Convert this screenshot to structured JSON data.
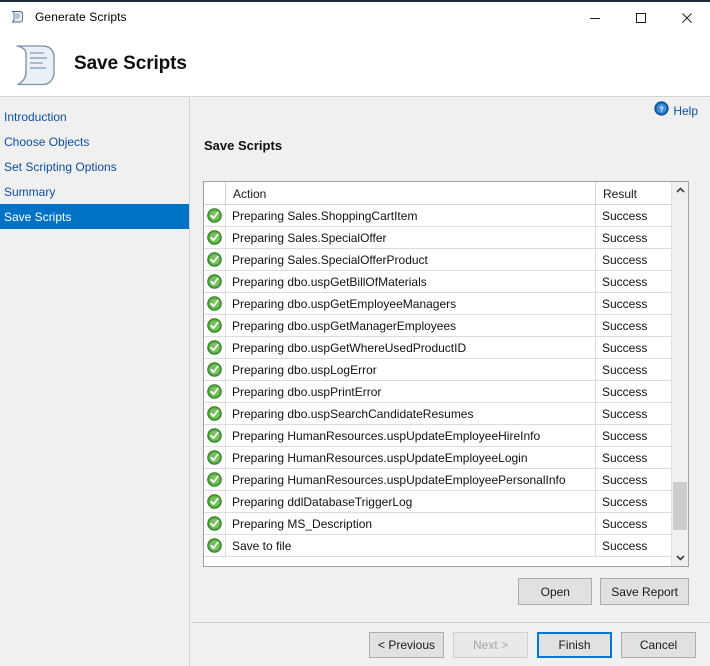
{
  "window": {
    "title": "Generate Scripts",
    "icon": "script-scroll-icon",
    "minimize_label": "Minimize",
    "maximize_label": "Maximize",
    "close_label": "Close"
  },
  "banner": {
    "title": "Save Scripts",
    "icon": "script-scroll-icon"
  },
  "sidebar": {
    "items": [
      {
        "label": "Introduction",
        "selected": false
      },
      {
        "label": "Choose Objects",
        "selected": false
      },
      {
        "label": "Set Scripting Options",
        "selected": false
      },
      {
        "label": "Summary",
        "selected": false
      },
      {
        "label": "Save Scripts",
        "selected": true
      }
    ]
  },
  "main": {
    "help_label": "Help",
    "help_icon": "help-circle-icon",
    "section_title": "Save Scripts"
  },
  "grid": {
    "columns": {
      "icon": "",
      "action": "Action",
      "result": "Result"
    },
    "rows": [
      {
        "status": "success-icon",
        "action": "Preparing Sales.ShoppingCartItem",
        "result": "Success"
      },
      {
        "status": "success-icon",
        "action": "Preparing Sales.SpecialOffer",
        "result": "Success"
      },
      {
        "status": "success-icon",
        "action": "Preparing Sales.SpecialOfferProduct",
        "result": "Success"
      },
      {
        "status": "success-icon",
        "action": "Preparing dbo.uspGetBillOfMaterials",
        "result": "Success"
      },
      {
        "status": "success-icon",
        "action": "Preparing dbo.uspGetEmployeeManagers",
        "result": "Success"
      },
      {
        "status": "success-icon",
        "action": "Preparing dbo.uspGetManagerEmployees",
        "result": "Success"
      },
      {
        "status": "success-icon",
        "action": "Preparing dbo.uspGetWhereUsedProductID",
        "result": "Success"
      },
      {
        "status": "success-icon",
        "action": "Preparing dbo.uspLogError",
        "result": "Success"
      },
      {
        "status": "success-icon",
        "action": "Preparing dbo.uspPrintError",
        "result": "Success"
      },
      {
        "status": "success-icon",
        "action": "Preparing dbo.uspSearchCandidateResumes",
        "result": "Success"
      },
      {
        "status": "success-icon",
        "action": "Preparing HumanResources.uspUpdateEmployeeHireInfo",
        "result": "Success"
      },
      {
        "status": "success-icon",
        "action": "Preparing HumanResources.uspUpdateEmployeeLogin",
        "result": "Success"
      },
      {
        "status": "success-icon",
        "action": "Preparing HumanResources.uspUpdateEmployeePersonalInfo",
        "result": "Success"
      },
      {
        "status": "success-icon",
        "action": "Preparing ddlDatabaseTriggerLog",
        "result": "Success"
      },
      {
        "status": "success-icon",
        "action": "Preparing MS_Description",
        "result": "Success"
      },
      {
        "status": "success-icon",
        "action": "Save to file",
        "result": "Success"
      }
    ],
    "scrollbar": {
      "up_arrow": "chevron-up-icon",
      "down_arrow": "chevron-down-icon"
    },
    "open_label": "Open",
    "save_report_label": "Save Report"
  },
  "footer": {
    "previous_label": "< Previous",
    "next_label": "Next >",
    "finish_label": "Finish",
    "cancel_label": "Cancel"
  },
  "colors": {
    "accent": "#0072c6",
    "focus": "#0078d7",
    "link": "#0b4f9e",
    "success": "#3aa02c",
    "panel": "#f0f0f0"
  }
}
